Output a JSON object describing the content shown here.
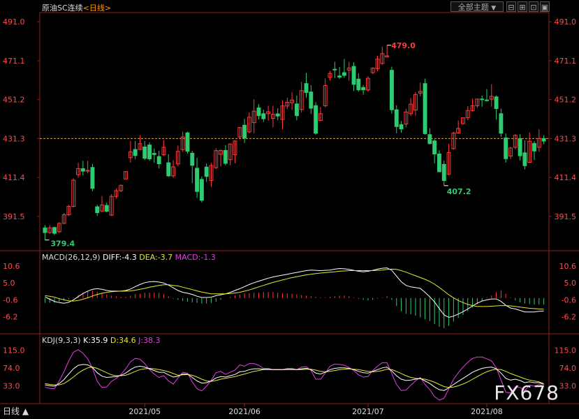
{
  "header": {
    "title": "原油SC连续",
    "period_tag": "<日线>",
    "theme_button": "全部主题",
    "theme_arrow": "▼"
  },
  "price_panel": {
    "y_ticks": [
      "491.0",
      "471.1",
      "451.2",
      "431.3",
      "411.4",
      "391.5"
    ],
    "high_label": "479.0",
    "low_label": "379.4",
    "low2_label": "407.2",
    "last_price": 431.3
  },
  "macd_panel": {
    "title": "MACD(26,12,9)",
    "diff": "DIFF:-4.3",
    "dea": "DEA:-3.7",
    "macd": "MACD:-1.3",
    "y_ticks": [
      "10.6",
      "5.0",
      "-0.6",
      "-6.2"
    ]
  },
  "kdj_panel": {
    "title": "KDJ(9,3,3)",
    "k": "K:35.9",
    "d": "D:34.6",
    "j": "J:38.3",
    "y_ticks": [
      "115.0",
      "74.0",
      "33.0"
    ]
  },
  "x_axis": [
    "2021/05",
    "2021/06",
    "2021/07",
    "2021/08"
  ],
  "footer": {
    "period_label": "日线 ▲",
    "watermark": "FX678"
  },
  "colors": {
    "up": "#ff3b3b",
    "down": "#2ecc71",
    "diff": "#ffffff",
    "dea": "#e8e830",
    "j": "#e040e0",
    "axis": "#ff4d4d",
    "grid": "#8b2020"
  },
  "chart_data": {
    "type": "candlestick",
    "price_range": [
      375,
      495
    ],
    "candles": [
      [
        385.6,
        383.2,
        387.0,
        379.4
      ],
      [
        383.2,
        385.6,
        387.0,
        382.5
      ],
      [
        385.8,
        382.8,
        386.2,
        381.9
      ],
      [
        383.6,
        387.9,
        388.5,
        383.0
      ],
      [
        387.9,
        392.3,
        393.2,
        387.5
      ],
      [
        392.3,
        396.6,
        397.4,
        391.7
      ],
      [
        396.6,
        410.0,
        411.0,
        396.0
      ],
      [
        412.8,
        415.9,
        418.9,
        411.2
      ],
      [
        415.9,
        414.6,
        419.9,
        412.5
      ],
      [
        414.6,
        415.0,
        419.9,
        413.6
      ],
      [
        416.5,
        405.8,
        418.3,
        404.4
      ],
      [
        396.4,
        393.4,
        397.4,
        391.7
      ],
      [
        394.2,
        397.3,
        401.9,
        393.4
      ],
      [
        397.1,
        394.1,
        398.5,
        393.5
      ],
      [
        392.1,
        401.7,
        402.8,
        391.7
      ],
      [
        401.7,
        404.6,
        405.8,
        400.6
      ],
      [
        404.6,
        407.4,
        407.7,
        403.9
      ],
      [
        410.6,
        414.4,
        414.4,
        410.6
      ],
      [
        421.5,
        424.5,
        430.0,
        419.0
      ],
      [
        425.7,
        422.6,
        430.0,
        420.8
      ],
      [
        425.7,
        428.7,
        432.9,
        425.4
      ],
      [
        427.0,
        421.2,
        430.0,
        420.3
      ],
      [
        428.0,
        420.9,
        429.4,
        419.9
      ],
      [
        423.7,
        423.1,
        426.2,
        418.9
      ],
      [
        422.1,
        418.4,
        425.1,
        416.0
      ],
      [
        423.0,
        426.8,
        430.4,
        422.3
      ],
      [
        418.9,
        412.2,
        423.3,
        411.6
      ],
      [
        412.2,
        416.8,
        420.3,
        411.2
      ],
      [
        418.3,
        424.7,
        427.7,
        417.1
      ],
      [
        425.6,
        432.1,
        434.8,
        424.5
      ],
      [
        434.2,
        424.8,
        434.8,
        423.6
      ],
      [
        423.8,
        417.6,
        425.0,
        408.4
      ],
      [
        416.1,
        404.2,
        421.5,
        400.9
      ],
      [
        410.4,
        399.7,
        411.9,
        398.6
      ],
      [
        416.7,
        411.9,
        418.6,
        409.1
      ],
      [
        409.8,
        417.5,
        418.9,
        406.6
      ],
      [
        416.4,
        425.1,
        426.3,
        415.6
      ],
      [
        423.2,
        425.2,
        425.7,
        417.1
      ],
      [
        425.2,
        418.6,
        428.0,
        417.6
      ],
      [
        420.5,
        428.5,
        428.7,
        417.6
      ],
      [
        423.0,
        430.0,
        430.4,
        418.6
      ],
      [
        432.1,
        436.9,
        437.2,
        431.5
      ],
      [
        438.1,
        431.5,
        441.4,
        429.0
      ],
      [
        434.7,
        442.2,
        444.7,
        434.0
      ],
      [
        439.4,
        445.3,
        451.4,
        434.0
      ],
      [
        447.0,
        443.0,
        448.9,
        441.0
      ],
      [
        444.0,
        441.4,
        446.0,
        439.8
      ],
      [
        444.0,
        445.0,
        448.1,
        440.4
      ],
      [
        441.6,
        443.7,
        448.1,
        437.1
      ],
      [
        443.9,
        442.8,
        446.8,
        440.6
      ],
      [
        441.0,
        448.0,
        450.9,
        436.0
      ],
      [
        447.9,
        449.8,
        452.2,
        446.3
      ],
      [
        449.6,
        451.0,
        454.9,
        445.9
      ],
      [
        449.0,
        443.0,
        453.3,
        440.6
      ],
      [
        446.1,
        455.8,
        460.3,
        444.6
      ],
      [
        459.4,
        454.8,
        464.8,
        452.2
      ],
      [
        455.1,
        446.8,
        458.6,
        443.9
      ],
      [
        448.1,
        434.0,
        449.9,
        433.3
      ],
      [
        440.5,
        444.0,
        447.4,
        440.3
      ],
      [
        448.0,
        458.4,
        462.0,
        447.3
      ],
      [
        462.6,
        464.6,
        465.8,
        461.0
      ],
      [
        466.7,
        466.5,
        470.6,
        462.2
      ],
      [
        463.3,
        462.7,
        467.9,
        461.8
      ],
      [
        465.0,
        463.6,
        472.0,
        462.4
      ],
      [
        466.3,
        467.4,
        470.5,
        460.9
      ],
      [
        468.2,
        459.0,
        470.3,
        455.6
      ],
      [
        461.7,
        456.2,
        464.6,
        455.3
      ],
      [
        457.4,
        456.2,
        458.6,
        453.7
      ],
      [
        456.1,
        462.1,
        463.2,
        455.2
      ],
      [
        465.0,
        467.3,
        467.8,
        464.2
      ],
      [
        467.0,
        471.9,
        473.6,
        465.7
      ],
      [
        469.7,
        474.7,
        478.3,
        469.0
      ],
      [
        473.0,
        473.6,
        479.0,
        472.8
      ],
      [
        466.2,
        446.0,
        468.0,
        444.0
      ],
      [
        446.0,
        437.4,
        448.3,
        434.0
      ],
      [
        438.4,
        436.2,
        440.2,
        434.3
      ],
      [
        438.7,
        444.9,
        446.5,
        437.0
      ],
      [
        444.0,
        448.9,
        452.0,
        442.8
      ],
      [
        445.9,
        453.8,
        455.0,
        443.0
      ],
      [
        454.5,
        455.4,
        459.9,
        452.9
      ],
      [
        459.4,
        433.8,
        461.9,
        433.3
      ],
      [
        433.3,
        428.7,
        436.6,
        428.3
      ],
      [
        430.1,
        423.4,
        431.0,
        418.6
      ],
      [
        423.4,
        414.3,
        425.3,
        414.1
      ],
      [
        418.1,
        409.8,
        420.0,
        407.2
      ],
      [
        413.1,
        424.1,
        428.6,
        412.5
      ],
      [
        426.1,
        434.1,
        434.8,
        425.6
      ],
      [
        434.1,
        436.5,
        440.6,
        433.8
      ],
      [
        438.9,
        441.9,
        442.2,
        438.4
      ],
      [
        442.0,
        445.6,
        447.9,
        440.6
      ],
      [
        445.6,
        448.1,
        451.7,
        445.1
      ],
      [
        448.1,
        451.5,
        451.5,
        447.1
      ],
      [
        451.5,
        451.4,
        453.3,
        447.6
      ],
      [
        451.0,
        450.8,
        456.6,
        450.2
      ],
      [
        451.4,
        452.9,
        459.0,
        447.6
      ],
      [
        452.6,
        446.6,
        453.3,
        441.0
      ],
      [
        444.0,
        434.0,
        446.6,
        432.1
      ],
      [
        431.6,
        421.0,
        433.9,
        419.0
      ],
      [
        422.3,
        426.5,
        427.0,
        420.8
      ],
      [
        426.8,
        432.9,
        433.5,
        425.8
      ],
      [
        431.3,
        422.5,
        433.5,
        420.1
      ],
      [
        424.0,
        417.4,
        430.4,
        415.5
      ],
      [
        419.1,
        429.9,
        434.4,
        418.9
      ],
      [
        428.8,
        424.9,
        430.0,
        420.3
      ],
      [
        426.8,
        431.3,
        436.0,
        424.5
      ],
      [
        431.3,
        430.0,
        433.0,
        428.4
      ]
    ],
    "macd": {
      "diff": [
        0.4,
        -0.4,
        -1.1,
        -1.5,
        -1.7,
        -1.4,
        -0.6,
        0.5,
        1.5,
        2.3,
        2.9,
        3.1,
        2.9,
        2.5,
        2.3,
        2.3,
        2.3,
        2.5,
        3.0,
        3.8,
        4.5,
        5.1,
        5.4,
        5.5,
        5.3,
        5.0,
        4.3,
        3.4,
        2.5,
        1.9,
        1.6,
        1.2,
        0.6,
        0.2,
        0.2,
        0.3,
        0.8,
        1.1,
        1.4,
        1.9,
        2.5,
        3.1,
        3.8,
        4.5,
        5.1,
        5.6,
        6.1,
        6.6,
        7.0,
        7.3,
        7.6,
        7.9,
        8.2,
        8.5,
        8.8,
        9.1,
        9.3,
        9.2,
        9.1,
        9.2,
        9.3,
        9.6,
        9.8,
        9.7,
        9.5,
        9.2,
        8.9,
        8.7,
        8.9,
        9.2,
        9.6,
        9.9,
        10.0,
        9.2,
        7.3,
        5.4,
        4.2,
        3.7,
        3.5,
        3.2,
        1.9,
        0.4,
        -1.3,
        -3.5,
        -5.6,
        -6.4,
        -6.0,
        -5.3,
        -4.5,
        -3.6,
        -2.6,
        -1.7,
        -1.0,
        -0.6,
        -0.3,
        -0.3,
        -1.1,
        -2.4,
        -3.3,
        -3.6,
        -4.1,
        -4.6,
        -4.6,
        -4.6,
        -4.4,
        -4.3
      ],
      "dea": [
        0.8,
        0.6,
        0.3,
        -0.2,
        -0.6,
        -0.9,
        -1.0,
        -0.8,
        -0.4,
        0.1,
        0.7,
        1.2,
        1.6,
        1.9,
        2.1,
        2.2,
        2.3,
        2.3,
        2.4,
        2.6,
        2.9,
        3.2,
        3.6,
        3.9,
        4.2,
        4.4,
        4.4,
        4.2,
        4.0,
        3.6,
        3.2,
        2.8,
        2.4,
        2.0,
        1.7,
        1.4,
        1.4,
        1.4,
        1.4,
        1.5,
        1.7,
        1.9,
        2.3,
        2.7,
        3.2,
        3.7,
        4.2,
        4.7,
        5.2,
        5.6,
        6.0,
        6.4,
        6.8,
        7.1,
        7.4,
        7.7,
        7.9,
        8.1,
        8.3,
        8.4,
        8.6,
        8.7,
        8.9,
        9.0,
        9.1,
        9.1,
        9.1,
        9.1,
        9.1,
        9.1,
        9.2,
        9.3,
        9.5,
        9.6,
        9.5,
        9.1,
        8.6,
        8.0,
        7.4,
        6.8,
        6.2,
        5.5,
        4.6,
        3.5,
        2.3,
        1.1,
        0.1,
        -0.8,
        -1.5,
        -2.1,
        -2.5,
        -2.8,
        -2.8,
        -2.8,
        -2.7,
        -2.6,
        -2.5,
        -2.5,
        -2.6,
        -2.8,
        -3.0,
        -3.2,
        -3.4,
        -3.5,
        -3.6,
        -3.7
      ],
      "hist": [
        -1.6,
        -1.6,
        -1.6,
        -1.2,
        -0.8,
        -0.4,
        0.2,
        1.0,
        1.8,
        2.4,
        2.4,
        2.0,
        1.6,
        1.2,
        0.8,
        0.6,
        0.4,
        0.4,
        0.8,
        1.2,
        1.4,
        1.8,
        1.8,
        1.8,
        1.8,
        1.2,
        0.6,
        -0.2,
        -0.6,
        -1.0,
        -1.2,
        -1.4,
        -1.6,
        -1.8,
        -1.8,
        -1.6,
        -1.2,
        -0.6,
        0.0,
        0.4,
        0.8,
        1.2,
        1.6,
        1.6,
        1.8,
        1.8,
        2.0,
        2.0,
        2.0,
        1.8,
        1.6,
        1.6,
        1.4,
        1.2,
        1.0,
        0.8,
        0.6,
        0.4,
        0.2,
        0.2,
        0.4,
        0.6,
        0.8,
        0.8,
        0.6,
        0.2,
        -0.2,
        -0.6,
        -0.8,
        -0.6,
        -0.2,
        0.2,
        0.6,
        -0.6,
        -2.6,
        -4.4,
        -5.2,
        -5.4,
        -5.8,
        -6.4,
        -7.0,
        -7.6,
        -8.6,
        -9.6,
        -10.0,
        -9.2,
        -7.8,
        -6.6,
        -5.6,
        -4.4,
        -3.2,
        -2.0,
        -1.0,
        0.2,
        0.8,
        2.0,
        2.6,
        1.4,
        0.2,
        -0.8,
        -1.4,
        -1.8,
        -2.0,
        -2.2,
        -2.2,
        -2.2
      ]
    },
    "kdj": {
      "k": [
        35,
        33,
        32,
        38,
        47,
        60,
        72,
        80,
        82,
        81,
        75,
        63,
        55,
        52,
        53,
        54,
        57,
        62,
        70,
        76,
        78,
        76,
        72,
        68,
        64,
        64,
        58,
        53,
        55,
        60,
        60,
        52,
        44,
        39,
        40,
        44,
        51,
        54,
        53,
        56,
        59,
        65,
        66,
        70,
        72,
        72,
        71,
        71,
        70,
        70,
        70,
        71,
        71,
        70,
        72,
        73,
        70,
        62,
        60,
        64,
        70,
        73,
        74,
        74,
        73,
        70,
        66,
        63,
        62,
        66,
        70,
        74,
        76,
        67,
        56,
        48,
        45,
        46,
        48,
        50,
        44,
        38,
        30,
        24,
        22,
        28,
        36,
        43,
        50,
        57,
        64,
        69,
        73,
        75,
        76,
        72,
        62,
        50,
        46,
        48,
        45,
        40,
        42,
        40,
        40,
        36
      ],
      "d": [
        38,
        36,
        35,
        35,
        38,
        45,
        53,
        62,
        69,
        74,
        76,
        73,
        68,
        63,
        58,
        56,
        56,
        57,
        61,
        66,
        70,
        72,
        73,
        72,
        70,
        68,
        65,
        61,
        57,
        58,
        59,
        57,
        53,
        48,
        44,
        43,
        45,
        48,
        50,
        52,
        54,
        57,
        60,
        63,
        66,
        68,
        70,
        70,
        70,
        70,
        70,
        70,
        70,
        70,
        70,
        71,
        71,
        69,
        66,
        65,
        66,
        68,
        70,
        71,
        72,
        71,
        70,
        68,
        66,
        65,
        66,
        68,
        71,
        70,
        66,
        61,
        56,
        52,
        50,
        49,
        48,
        45,
        41,
        36,
        31,
        29,
        30,
        33,
        37,
        42,
        48,
        54,
        60,
        65,
        69,
        71,
        70,
        66,
        61,
        57,
        53,
        49,
        46,
        44,
        42,
        38
      ],
      "j": [
        30,
        27,
        26,
        44,
        65,
        90,
        110,
        116,
        108,
        95,
        73,
        43,
        29,
        30,
        43,
        50,
        59,
        72,
        88,
        96,
        94,
        84,
        70,
        60,
        52,
        56,
        44,
        37,
        51,
        64,
        62,
        42,
        26,
        21,
        32,
        46,
        63,
        66,
        59,
        64,
        69,
        81,
        78,
        84,
        84,
        80,
        73,
        73,
        70,
        70,
        70,
        73,
        73,
        70,
        76,
        77,
        68,
        48,
        48,
        62,
        78,
        83,
        82,
        80,
        75,
        68,
        58,
        53,
        54,
        68,
        78,
        86,
        86,
        61,
        36,
        22,
        23,
        34,
        44,
        52,
        36,
        24,
        8,
        0,
        4,
        26,
        48,
        63,
        76,
        87,
        96,
        99,
        99,
        95,
        90,
        74,
        46,
        18,
        16,
        30,
        29,
        22,
        34,
        32,
        36,
        32
      ]
    }
  }
}
